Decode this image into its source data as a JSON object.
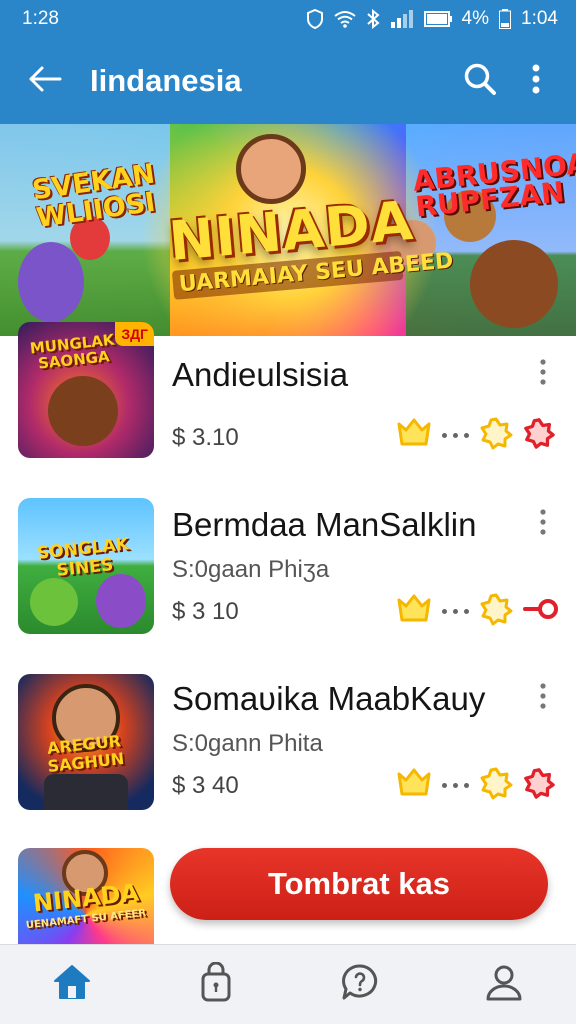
{
  "status_bar": {
    "time_left": "1:28",
    "battery": "4%",
    "time_right": "1:04"
  },
  "app_bar": {
    "title": "Iindanesia"
  },
  "banner": {
    "left_text": "SVEKAN WLIIOSI",
    "right_text": "ABRUSNOAS RUPFZAN",
    "main_title": "NINADA",
    "main_subtitle": "UARMAIAY SEU ABEED"
  },
  "items": [
    {
      "title": "Andieulsisia",
      "subtitle": "",
      "price": "$ 3.10",
      "thumb_text": "MUNGLAK SAONGA",
      "thumb_corner": "ЗДГ",
      "end_badge": "flower"
    },
    {
      "title": "Bermdaa ManSalklin",
      "subtitle": "S:0gaan Phiʒa",
      "price": "$ 3 10",
      "thumb_text": "SONGLAK SINES",
      "end_badge": "key"
    },
    {
      "title": "Somaʋika MaabKauy",
      "subtitle": "S:0gann Phita",
      "price": "$ 3 40",
      "thumb_text": "AREGUR SAGHUN",
      "end_badge": "flower"
    },
    {
      "title": "",
      "subtitle": "",
      "price": "",
      "thumb_text": "NINADA",
      "thumb_sub": "UENAMAFT SU AFEER",
      "end_badge": ""
    }
  ],
  "cta": {
    "label": "Tombrat kas"
  },
  "bottom_nav": [
    {
      "name": "home",
      "icon": "home-icon",
      "active": true
    },
    {
      "name": "bag",
      "icon": "lock-bag-icon",
      "active": false
    },
    {
      "name": "chat",
      "icon": "chat-bubble-icon",
      "active": false
    },
    {
      "name": "profile",
      "icon": "person-icon",
      "active": false
    }
  ],
  "colors": {
    "primary": "#2a86c8",
    "cta": "#d92a1f",
    "nav_active": "#1f7bc0",
    "badge_yellow": "#f5b700",
    "badge_red": "#e0202a"
  }
}
